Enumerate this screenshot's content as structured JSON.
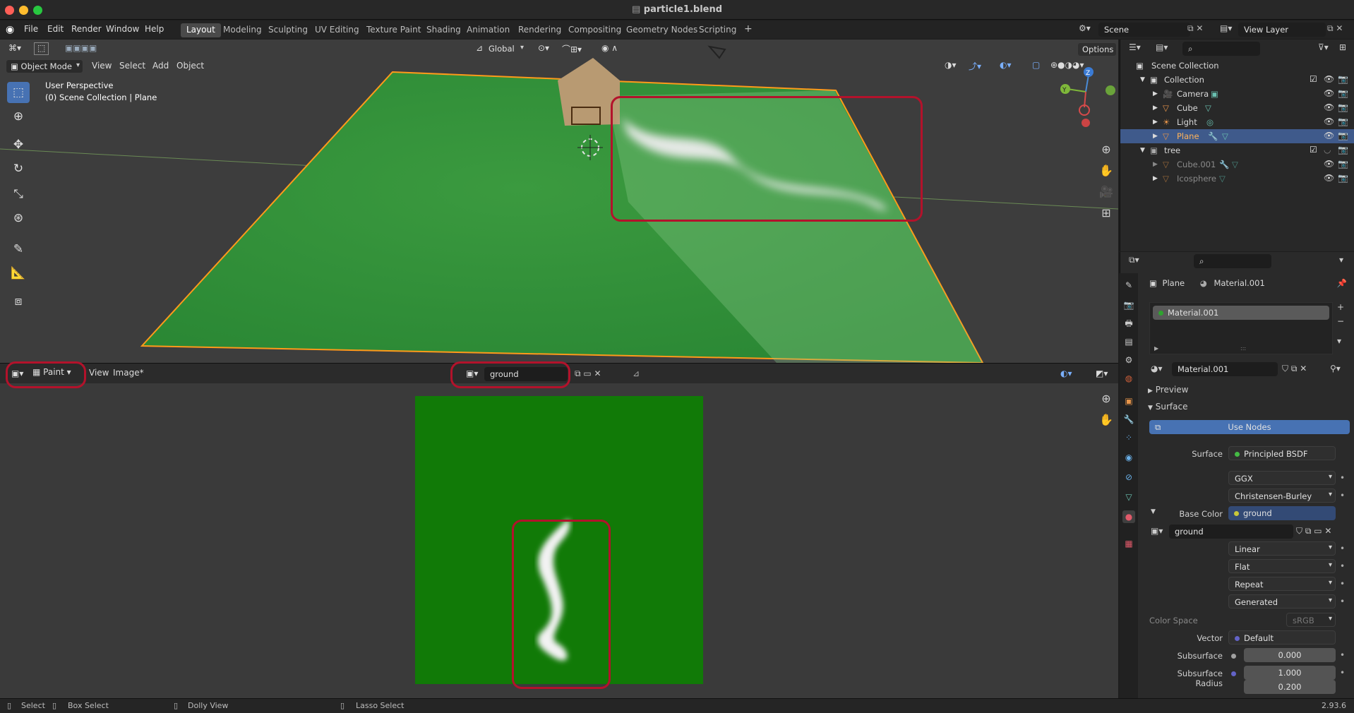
{
  "window": {
    "title": "particle1.blend"
  },
  "menus": [
    "File",
    "Edit",
    "Render",
    "Window",
    "Help"
  ],
  "workspaces": [
    "Layout",
    "Modeling",
    "Sculpting",
    "UV Editing",
    "Texture Paint",
    "Shading",
    "Animation",
    "Rendering",
    "Compositing",
    "Geometry Nodes",
    "Scripting"
  ],
  "active_workspace": "Layout",
  "scene": {
    "name": "Scene",
    "view_layer": "View Layer"
  },
  "viewport": {
    "mode": "Object Mode",
    "menu": [
      "View",
      "Select",
      "Add",
      "Object"
    ],
    "transform_orientation": "Global",
    "options": "Options",
    "overlay_line1": "User Perspective",
    "overlay_line2": "(0) Scene Collection | Plane",
    "axes": {
      "x": "X",
      "y": "Y",
      "z": "Z"
    }
  },
  "image_editor": {
    "mode": "Paint",
    "menu": [
      "View",
      "Image*"
    ],
    "image_name": "ground"
  },
  "outliner": {
    "root": "Scene Collection",
    "rows": [
      {
        "label": "Collection",
        "level": 1
      },
      {
        "label": "Camera",
        "level": 2
      },
      {
        "label": "Cube",
        "level": 2
      },
      {
        "label": "Light",
        "level": 2
      },
      {
        "label": "Plane",
        "level": 2,
        "selected": true
      },
      {
        "label": "tree",
        "level": 1
      },
      {
        "label": "Cube.001",
        "level": 2,
        "dim": true
      },
      {
        "label": "Icosphere",
        "level": 2,
        "dim": true
      }
    ]
  },
  "properties": {
    "breadcrumb_object": "Plane",
    "breadcrumb_material": "Material.001",
    "slot": "Material.001",
    "material_name": "Material.001",
    "panel_preview": "Preview",
    "panel_surface": "Surface",
    "use_nodes": "Use Nodes",
    "surface_label": "Surface",
    "surface_value": "Principled BSDF",
    "distribution": "GGX",
    "subsurface_method": "Christensen-Burley",
    "base_color_label": "Base Color",
    "base_color_value": "ground",
    "image_name": "ground",
    "interpolation": "Linear",
    "projection": "Flat",
    "extension": "Repeat",
    "source": "Generated",
    "color_space_label": "Color Space",
    "color_space_value": "sRGB",
    "vector_label": "Vector",
    "vector_value": "Default",
    "subsurface_label": "Subsurface",
    "subsurface_value": "0.000",
    "subsurface_radius_label": "Subsurface Radius",
    "subsurface_radius_1": "1.000",
    "subsurface_radius_2": "0.200"
  },
  "status": {
    "select": "Select",
    "box_select": "Box Select",
    "dolly_view": "Dolly View",
    "lasso_select": "Lasso Select",
    "version": "2.93.6"
  },
  "colors": {
    "accent": "#4772b3",
    "highlight_box": "#b3122b",
    "paint_green": "#117a07"
  }
}
